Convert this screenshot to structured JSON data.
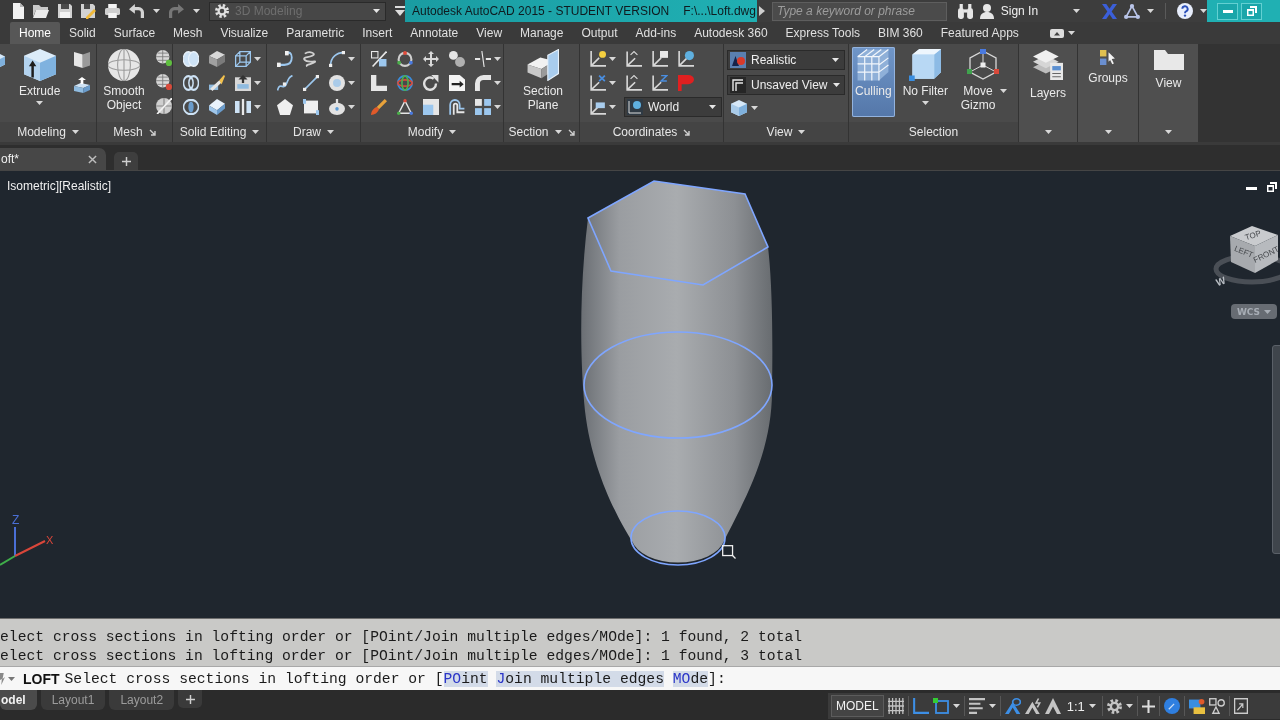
{
  "quick_access": {
    "undo": {
      "disabled": false
    },
    "redo": {
      "disabled": true
    },
    "workspace": {
      "value": "3D Modeling",
      "disabled": true
    }
  },
  "title_bar": {
    "title": "Autodesk AutoCAD 2015 - STUDENT VERSION",
    "file": "F:\\...\\Loft.dwg"
  },
  "search": {
    "placeholder": "Type a keyword or phrase"
  },
  "account": {
    "label": "Sign In"
  },
  "ribbon_tabs": [
    {
      "label": "Home",
      "selected": true
    },
    {
      "label": "Solid",
      "selected": false
    },
    {
      "label": "Surface",
      "selected": false
    },
    {
      "label": "Mesh",
      "selected": false
    },
    {
      "label": "Visualize",
      "selected": false
    },
    {
      "label": "Parametric",
      "selected": false
    },
    {
      "label": "Insert",
      "selected": false
    },
    {
      "label": "Annotate",
      "selected": false
    },
    {
      "label": "View",
      "selected": false
    },
    {
      "label": "Manage",
      "selected": false
    },
    {
      "label": "Output",
      "selected": false
    },
    {
      "label": "Add-ins",
      "selected": false
    },
    {
      "label": "Autodesk 360",
      "selected": false
    },
    {
      "label": "Express Tools",
      "selected": false
    },
    {
      "label": "BIM 360",
      "selected": false
    },
    {
      "label": "Featured Apps",
      "selected": false
    }
  ],
  "ribbon_panels": [
    {
      "kind": "modeling",
      "title": "Modeling",
      "buttons": [
        {
          "label": "Extrude",
          "on": false
        }
      ]
    },
    {
      "kind": "mesh",
      "title": "Mesh",
      "buttons": [
        {
          "label": "Smooth Object",
          "on": false
        }
      ]
    },
    {
      "kind": "solid_editing",
      "title": "Solid Editing"
    },
    {
      "kind": "draw",
      "title": "Draw"
    },
    {
      "kind": "modify",
      "title": "Modify"
    },
    {
      "kind": "section",
      "title": "Section",
      "buttons": [
        {
          "label": "Section Plane",
          "on": false
        }
      ]
    },
    {
      "kind": "coordinates",
      "title": "Coordinates",
      "dropdowns": [
        {
          "value": "World"
        }
      ]
    },
    {
      "kind": "view",
      "title": "View",
      "dropdowns": [
        {
          "value": "Realistic"
        },
        {
          "value": "Unsaved View"
        }
      ]
    },
    {
      "kind": "selection",
      "title": "Selection",
      "buttons": [
        {
          "label": "Culling",
          "on": true
        },
        {
          "label": "No Filter",
          "on": false
        },
        {
          "label": "Move Gizmo",
          "on": false
        }
      ]
    },
    {
      "kind": "layers",
      "title": "Layers"
    },
    {
      "kind": "groups",
      "title": "Groups"
    },
    {
      "kind": "view_collapsed",
      "title": "View"
    }
  ],
  "file_tabs": [
    {
      "label": "oft*",
      "selected": true
    }
  ],
  "viewport": {
    "label": "Isometric][Realistic]",
    "viewcube": {
      "top": "TOP",
      "left": "LEFT",
      "front": "FRONT",
      "compass": "W"
    },
    "coordinate_system": "WCS",
    "ucs_icon": {
      "x": "X",
      "z": "Z"
    }
  },
  "command_history": [
    "elect cross sections in lofting order or [POint/Join multiple edges/MOde]: 1 found, 2 total",
    "elect cross sections in lofting order or [POint/Join multiple edges/MOde]: 1 found, 3 total"
  ],
  "command_line": {
    "command": "LOFT",
    "prompt": "Select cross sections in lofting order or [",
    "options": [
      {
        "key": "PO",
        "rest": "int"
      },
      {
        "key": "J",
        "rest": "oin multiple edges"
      },
      {
        "key": "MO",
        "rest": "de"
      }
    ],
    "end": "]:"
  },
  "layout_tabs": [
    {
      "label": "odel",
      "selected": true
    },
    {
      "label": "Layout1",
      "selected": false
    },
    {
      "label": "Layout2",
      "selected": false
    }
  ],
  "status_bar": {
    "space": "MODEL",
    "toggles": [
      {
        "kind": "grid",
        "on": false
      },
      {
        "kind": "ortho",
        "on": true
      },
      {
        "kind": "snap",
        "on": true
      },
      {
        "kind": "lineweight",
        "on": false
      },
      {
        "kind": "annotation",
        "on": true
      },
      {
        "kind": "autoscale",
        "on": false
      },
      {
        "kind": "visibility",
        "on": false
      }
    ],
    "scale": "1:1",
    "display": {
      "on": true
    }
  }
}
